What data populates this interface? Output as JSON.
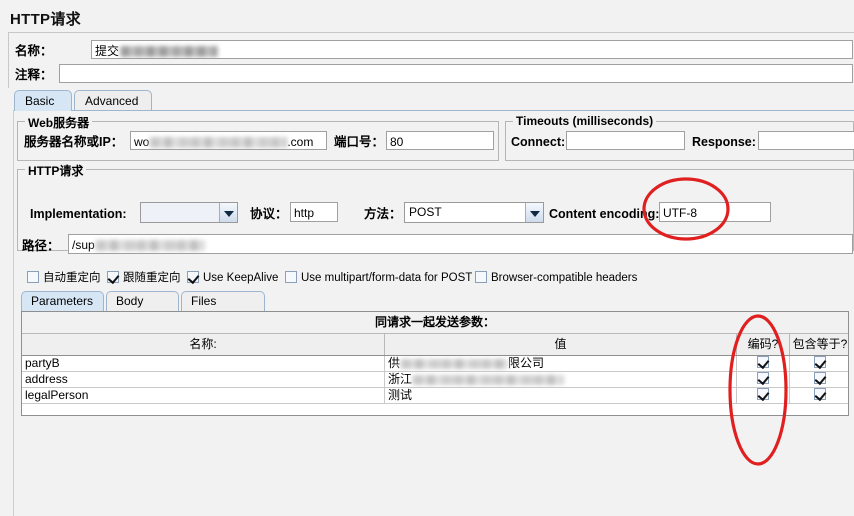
{
  "window": {
    "title": "HTTP请求"
  },
  "header": {
    "name_label": "名称：",
    "name_value": "提交",
    "comment_label": "注释：",
    "comment_value": ""
  },
  "tabs": [
    {
      "label": "Basic",
      "active": true
    },
    {
      "label": "Advanced",
      "active": false
    }
  ],
  "web_server": {
    "group_title": "Web服务器",
    "server_label": "服务器名称或IP：",
    "server_value_prefix": "wo",
    "server_value_suffix": ".com",
    "port_label": "端口号：",
    "port_value": "80"
  },
  "timeouts": {
    "group_title": "Timeouts (milliseconds)",
    "connect_label": "Connect:",
    "connect_value": "",
    "response_label": "Response:",
    "response_value": ""
  },
  "http_request": {
    "group_title": "HTTP请求",
    "implementation_label": "Implementation:",
    "implementation_value": "",
    "protocol_label": "协议：",
    "protocol_value": "http",
    "method_label": "方法：",
    "method_value": "POST",
    "content_encoding_label": "Content encoding:",
    "content_encoding_value": "UTF-8",
    "path_label": "路径：",
    "path_value": "/sup"
  },
  "options": [
    {
      "label": "自动重定向",
      "checked": false
    },
    {
      "label": "跟随重定向",
      "checked": true
    },
    {
      "label": "Use KeepAlive",
      "checked": true
    },
    {
      "label": "Use multipart/form-data for POST",
      "checked": false
    },
    {
      "label": "Browser-compatible headers",
      "checked": false
    }
  ],
  "inner_tabs": [
    {
      "label": "Parameters",
      "active": true
    },
    {
      "label": "Body Data",
      "active": false
    },
    {
      "label": "Files Upload",
      "active": false
    }
  ],
  "parameters_table": {
    "caption": "同请求一起发送参数：",
    "columns": [
      "名称:",
      "值",
      "编码?",
      "包含等于?"
    ],
    "rows": [
      {
        "name": "partyB",
        "value_prefix": "供",
        "value_suffix": "限公司",
        "encode": true,
        "include_equals": true
      },
      {
        "name": "address",
        "value_prefix": "浙江",
        "value_suffix": "",
        "encode": true,
        "include_equals": true
      },
      {
        "name": "legalPerson",
        "value_prefix": "测试",
        "value_suffix": "",
        "encode": true,
        "include_equals": true
      }
    ]
  },
  "annotations": {
    "accent_color": "#e02020",
    "marks": [
      {
        "target": "content-encoding-field"
      },
      {
        "target": "encode-column"
      }
    ]
  }
}
